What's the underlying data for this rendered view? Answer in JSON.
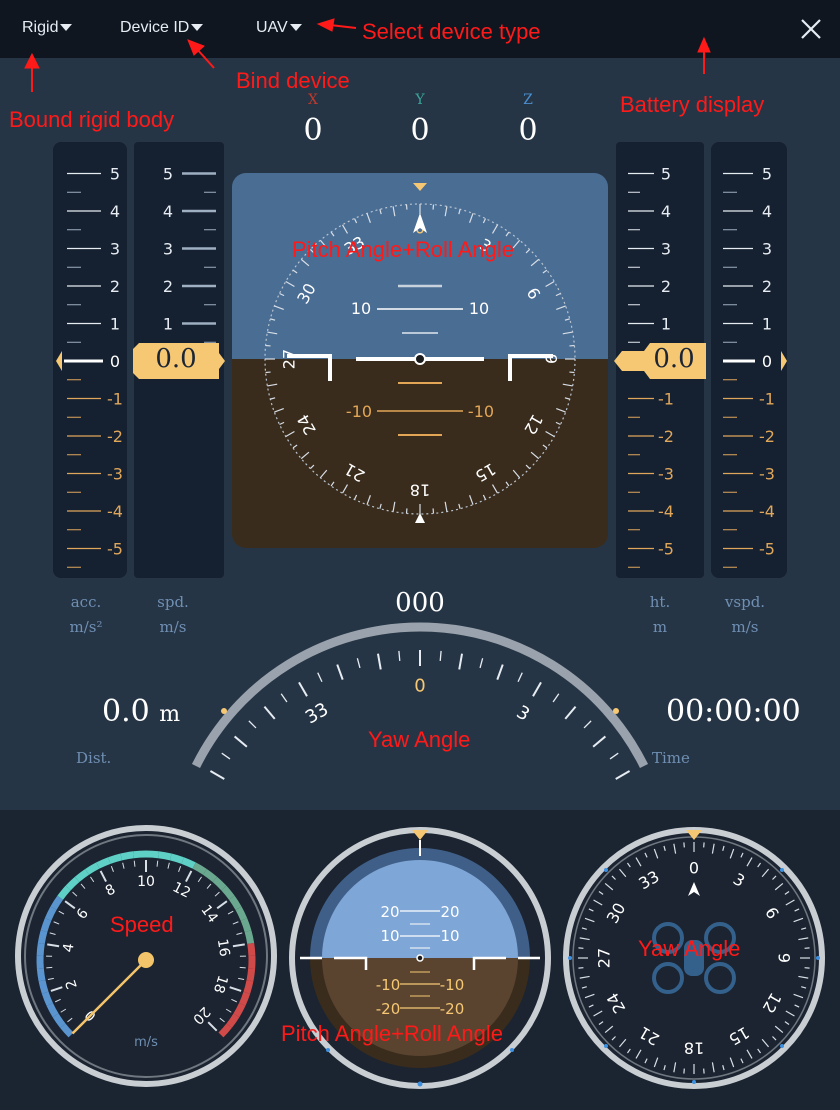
{
  "toolbar": {
    "rigid_label": "Rigid",
    "device_id_label": "Device ID",
    "device_type_label": "UAV"
  },
  "annotations": {
    "select_device_type": "Select device type",
    "bind_device": "Bind device",
    "bound_rigid_body": "Bound rigid body",
    "battery_display": "Battery display",
    "pitch_roll_main": "Pitch Angle+Roll Angle",
    "yaw_main": "Yaw Angle",
    "speed_gauge": "Speed",
    "pitch_roll_small": "Pitch Angle+Roll Angle",
    "yaw_small": "Yaw Angle"
  },
  "position": {
    "x_label": "X",
    "x_value": "0",
    "y_label": "Y",
    "y_value": "0",
    "z_label": "Z",
    "z_value": "0"
  },
  "tapes": {
    "acc": {
      "caption": "acc.",
      "unit": "m/s²",
      "value": "0"
    },
    "spd": {
      "caption": "spd.",
      "unit": "m/s",
      "value": "0.0"
    },
    "ht": {
      "caption": "ht.",
      "unit": "m",
      "value": "0.0"
    },
    "vspd": {
      "caption": "vspd.",
      "unit": "m/s",
      "value": "0"
    }
  },
  "heading": {
    "value": "000"
  },
  "distance": {
    "value": "0.0",
    "unit": "m",
    "label": "Dist."
  },
  "time": {
    "value": "00:00:00",
    "label": "Time"
  },
  "speed_gauge": {
    "unit": "m/s",
    "value": 0
  },
  "colors": {
    "sky": "#4a6d94",
    "ground": "#3a2c1c",
    "accent": "#f7c873",
    "annotation": "#ff1a1a",
    "caption": "#6f8fb3"
  }
}
